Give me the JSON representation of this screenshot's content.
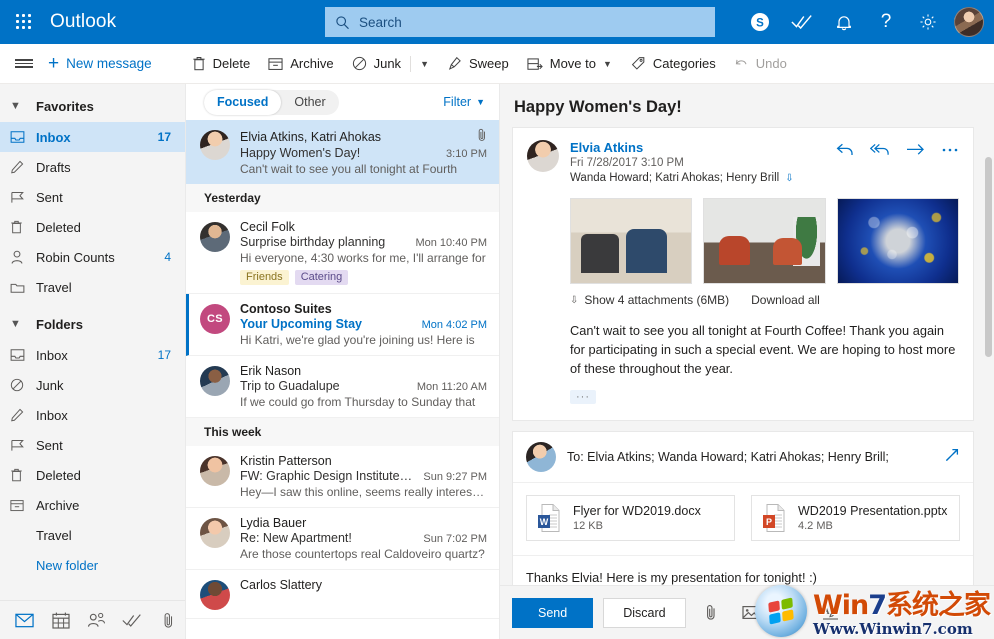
{
  "topbar": {
    "brand": "Outlook",
    "waffle_name": "app-launcher",
    "search_placeholder": "Search",
    "icons": [
      "skype-icon",
      "tasks-check-icon",
      "notification-bell-icon",
      "help-question-icon",
      "settings-gear-icon",
      "account-avatar"
    ],
    "skype_glyph": "S",
    "help_glyph": "?"
  },
  "commandbar": {
    "hamburger": "hamburger-menu",
    "new_message": "New message",
    "delete": "Delete",
    "archive": "Archive",
    "junk": "Junk",
    "sweep": "Sweep",
    "move_to": "Move to",
    "categories": "Categories",
    "undo": "Undo"
  },
  "sidebar": {
    "favorites_label": "Favorites",
    "favorites": [
      {
        "label": "Inbox",
        "count": "17",
        "icon": "inbox-icon",
        "selected": true
      },
      {
        "label": "Drafts",
        "count": "",
        "icon": "pencil-icon",
        "selected": false
      },
      {
        "label": "Sent",
        "count": "",
        "icon": "send-flag-icon",
        "selected": false
      },
      {
        "label": "Deleted",
        "count": "",
        "icon": "trash-icon",
        "selected": false
      },
      {
        "label": "Robin Counts",
        "count": "4",
        "icon": "person-icon",
        "selected": false
      },
      {
        "label": "Travel",
        "count": "",
        "icon": "folder-icon",
        "selected": false
      }
    ],
    "folders_label": "Folders",
    "folders": [
      {
        "label": "Inbox",
        "count": "17",
        "icon": "inbox-icon"
      },
      {
        "label": "Junk",
        "count": "",
        "icon": "junk-block-icon"
      },
      {
        "label": "Inbox",
        "count": "",
        "icon": "pencil-icon"
      },
      {
        "label": "Sent",
        "count": "",
        "icon": "send-flag-icon"
      },
      {
        "label": "Deleted",
        "count": "",
        "icon": "trash-icon"
      },
      {
        "label": "Archive",
        "count": "",
        "icon": "archive-icon"
      },
      {
        "label": "Travel",
        "count": "",
        "icon": ""
      }
    ],
    "new_folder": "New folder",
    "footer_icons": [
      "mail-icon",
      "calendar-icon",
      "people-icon",
      "tasks-icon",
      "files-clip-icon"
    ]
  },
  "list": {
    "tab_focused": "Focused",
    "tab_other": "Other",
    "filter": "Filter",
    "groups": [
      {
        "header": "",
        "messages": [
          {
            "sender": "Elvia Atkins, Katri Ahokas",
            "subject": "Happy Women's Day!",
            "time": "3:10 PM",
            "preview": "Can't wait to see you all tonight at Fourth",
            "selected": true,
            "unread": false,
            "has_attachment": true,
            "avatar": "avp1",
            "initials": "",
            "tags": []
          }
        ]
      },
      {
        "header": "Yesterday",
        "messages": [
          {
            "sender": "Cecil Folk",
            "subject": "Surprise birthday planning",
            "time": "Mon 10:40 PM",
            "preview": "Hi everyone, 4:30 works for me, I'll arrange for",
            "selected": false,
            "unread": false,
            "has_attachment": false,
            "avatar": "avp2",
            "initials": "",
            "tags": [
              {
                "label": "Friends",
                "bg": "#FBF3D2",
                "fg": "#8a7420"
              },
              {
                "label": "Catering",
                "bg": "#E3DAF1",
                "fg": "#5b4b8a"
              }
            ]
          },
          {
            "sender": "Contoso Suites",
            "subject": "Your Upcoming Stay",
            "time": "Mon 4:02 PM",
            "preview": "Hi Katri, we're glad you're joining us! Here is",
            "selected": false,
            "unread": true,
            "has_attachment": false,
            "avatar": "",
            "initials": "CS",
            "initials_bg": "#C2497F",
            "tags": []
          },
          {
            "sender": "Erik Nason",
            "subject": "Trip to Guadalupe",
            "time": "Mon 11:20 AM",
            "preview": "If we could go from Thursday to Sunday that",
            "selected": false,
            "unread": false,
            "has_attachment": false,
            "avatar": "avp3",
            "initials": "",
            "tags": []
          }
        ]
      },
      {
        "header": "This week",
        "messages": [
          {
            "sender": "Kristin Patterson",
            "subject": "FW: Graphic Design Institute Fi...",
            "time": "Sun 9:27 PM",
            "preview": "Hey—I saw this online, seems really interesting.",
            "selected": false,
            "unread": false,
            "has_attachment": false,
            "avatar": "avp4",
            "initials": "",
            "tags": []
          },
          {
            "sender": "Lydia Bauer",
            "subject": "Re: New Apartment!",
            "time": "Sun 7:02 PM",
            "preview": "Are those countertops real Caldoveiro quartz?",
            "selected": false,
            "unread": false,
            "has_attachment": false,
            "avatar": "avp5",
            "initials": "",
            "tags": []
          },
          {
            "sender": "Carlos Slattery",
            "subject": "",
            "time": "",
            "preview": "",
            "selected": false,
            "unread": false,
            "has_attachment": false,
            "avatar": "avp6",
            "initials": "",
            "tags": []
          }
        ]
      }
    ]
  },
  "reading": {
    "title": "Happy Women's Day!",
    "message": {
      "from": "Elvia Atkins",
      "date": "Fri 7/28/2017 3:10 PM",
      "recipients": "Wanda Howard; Katri Ahokas; Henry Brill",
      "actions": [
        "reply-icon",
        "reply-all-icon",
        "forward-icon",
        "more-actions-icon"
      ],
      "attachments_link": "Show 4 attachments (6MB)",
      "download_all": "Download all",
      "body": "Can't wait to see you all tonight at Fourth Coffee! Thank you again for participating in such a special event. We are hoping to host more of these throughout the year.",
      "expand_label": "···",
      "thumbnails": [
        "photo-two-women-laptop",
        "photo-office-lounge",
        "photo-blue-molecules"
      ]
    },
    "compose": {
      "to_label": "To: Elvia Atkins; Wanda Howard; Katri Ahokas; Henry Brill;",
      "popout_icon": "pop-out-icon",
      "attachments": [
        {
          "name": "Flyer for WD2019.docx",
          "size": "12 KB",
          "type": "word",
          "color": "#2b579a",
          "letter": "W"
        },
        {
          "name": "WD2019 Presentation.pptx",
          "size": "4.2 MB",
          "type": "powerpoint",
          "color": "#d24726",
          "letter": "P"
        }
      ],
      "body": "Thanks Elvia! Here is my presentation for tonight! :)",
      "send": "Send",
      "discard": "Discard",
      "tools": [
        "attach-clip-icon",
        "insert-picture-icon",
        "emoji-icon",
        "signature-icon"
      ]
    }
  },
  "watermark": {
    "line1_a": "Win",
    "line1_b": "7",
    "line1_c": "系统之家",
    "line2": "Www.Winwin7.com"
  }
}
